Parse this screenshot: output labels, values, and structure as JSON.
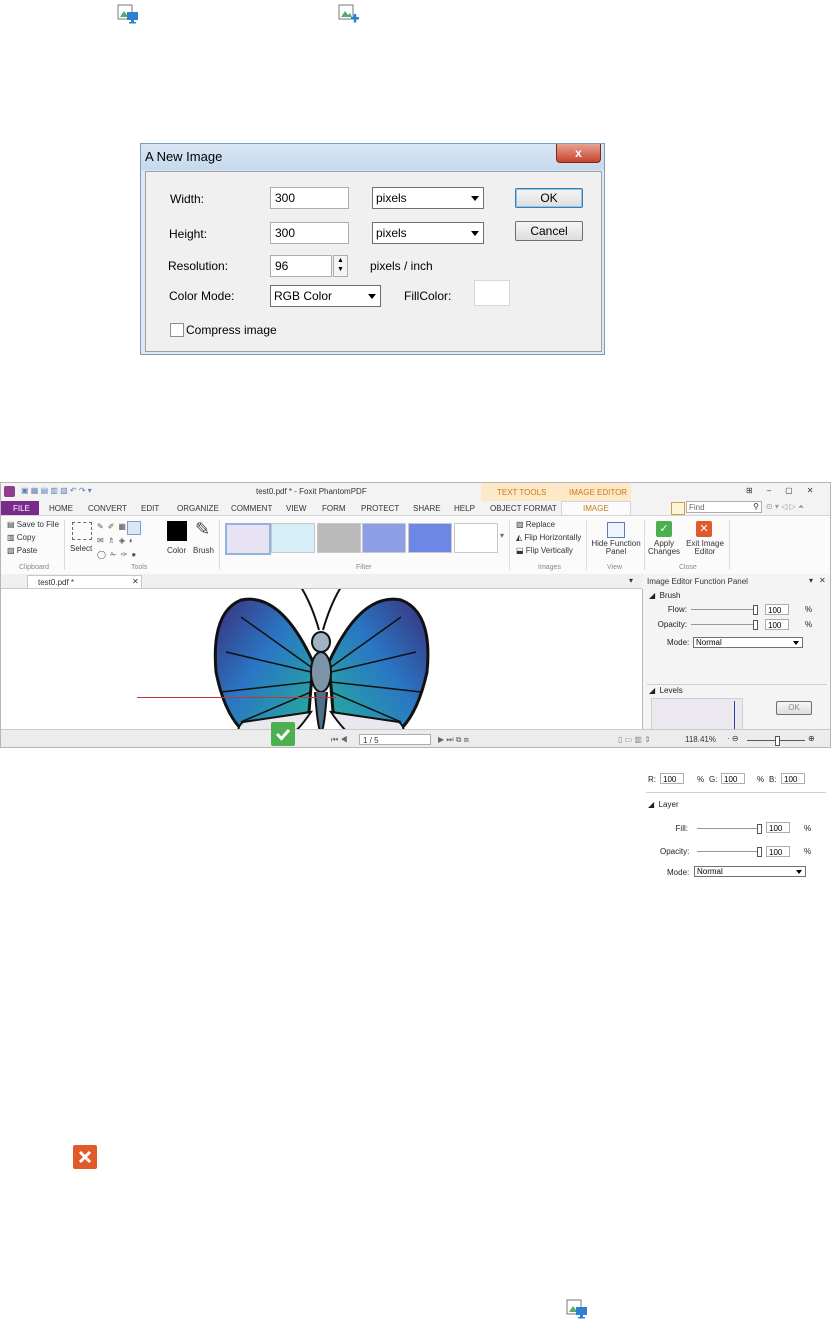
{
  "dialog": {
    "title": "A New Image",
    "close_glyph": "x",
    "width_label": "Width:",
    "width_value": "300",
    "width_unit": "pixels",
    "height_label": "Height:",
    "height_value": "300",
    "height_unit": "pixels",
    "resolution_label": "Resolution:",
    "resolution_value": "96",
    "resolution_unit": "pixels / inch",
    "colormode_label": "Color Mode:",
    "colormode_value": "RGB Color",
    "fillcolor_label": "FillColor:",
    "compress_label": "Compress image",
    "ok_label": "OK",
    "cancel_label": "Cancel"
  },
  "app": {
    "window_title": "test0.pdf * - Foxit PhantomPDF",
    "context_tabs": [
      "TEXT TOOLS",
      "IMAGE EDITOR"
    ],
    "menu": [
      "FILE",
      "HOME",
      "CONVERT",
      "EDIT",
      "ORGANIZE",
      "COMMENT",
      "VIEW",
      "FORM",
      "PROTECT",
      "SHARE",
      "HELP",
      "OBJECT FORMAT",
      "IMAGE"
    ],
    "search_placeholder": "Find",
    "clipboard": {
      "save": "Save to File",
      "copy": "Copy",
      "paste": "Paste",
      "group": "Clipboard"
    },
    "tools": {
      "select": "Select",
      "group": "Tools",
      "color": "Color",
      "brush": "Brush"
    },
    "filter_group": "Filter",
    "images": {
      "replace": "Replace",
      "flip_h": "Flip Horizontally",
      "flip_v": "Flip Vertically",
      "group": "Images"
    },
    "view": {
      "hide": "Hide Function Panel",
      "group": "View"
    },
    "close": {
      "apply": "Apply Changes",
      "exit": "Exit Image Editor",
      "group": "Close"
    },
    "doc_tab": "test0.pdf *",
    "panel": {
      "title": "Image Editor Function Panel",
      "brush": {
        "section": "Brush",
        "flow_label": "Flow:",
        "flow": "100",
        "opacity_label": "Opacity:",
        "opacity": "100",
        "mode_label": "Mode:",
        "mode": "Normal",
        "pct": "%"
      },
      "levels": {
        "section": "Levels",
        "ok": "OK",
        "r_label": "R:",
        "r": "100",
        "g_label": "G:",
        "g": "100",
        "b_label": "B:",
        "b": "100",
        "pct": "%"
      },
      "layer": {
        "section": "Layer",
        "fill_label": "Fill:",
        "fill": "100",
        "opacity_label": "Opacity:",
        "opacity": "100",
        "mode_label": "Mode:",
        "mode": "Normal",
        "pct": "%"
      }
    },
    "status": {
      "page": "1 / 5",
      "zoom": "118.41%"
    }
  }
}
